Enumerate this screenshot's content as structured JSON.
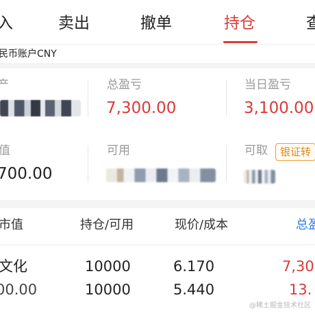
{
  "tabs": [
    {
      "label": "入",
      "active": false
    },
    {
      "label": "卖出",
      "active": false
    },
    {
      "label": "撤单",
      "active": false
    },
    {
      "label": "持仓",
      "active": true
    },
    {
      "label": "查",
      "active": false
    }
  ],
  "account": {
    "label": "民币账户CNY"
  },
  "summary": {
    "row1": {
      "assets_label": "产",
      "total_pl_label": "总盈亏",
      "total_pl_value": "7,300.00",
      "daily_pl_label": "当日盈亏",
      "daily_pl_value": "3,100.00"
    },
    "row2": {
      "value_label": "值",
      "value_value": "700.00",
      "available_label": "可用",
      "withdrawable_label": "可取",
      "transfer_button": "银证转"
    }
  },
  "holdings": {
    "headers": {
      "market_value": "市值",
      "position_available": "持仓/可用",
      "price_cost": "现价/成本",
      "total_pl": "总盈"
    },
    "rows": [
      {
        "name": "文化",
        "position": "10000",
        "price": "6.170",
        "pl": "7,30"
      },
      {
        "name": "00.00",
        "position": "10000",
        "price": "5.440",
        "pl": "13."
      }
    ]
  },
  "watermark": "@稀土掘金技术社区",
  "colors": {
    "accent_red": "#d93a3a",
    "header_blue": "#2e7cf0",
    "transfer_orange": "#e08a1e"
  }
}
